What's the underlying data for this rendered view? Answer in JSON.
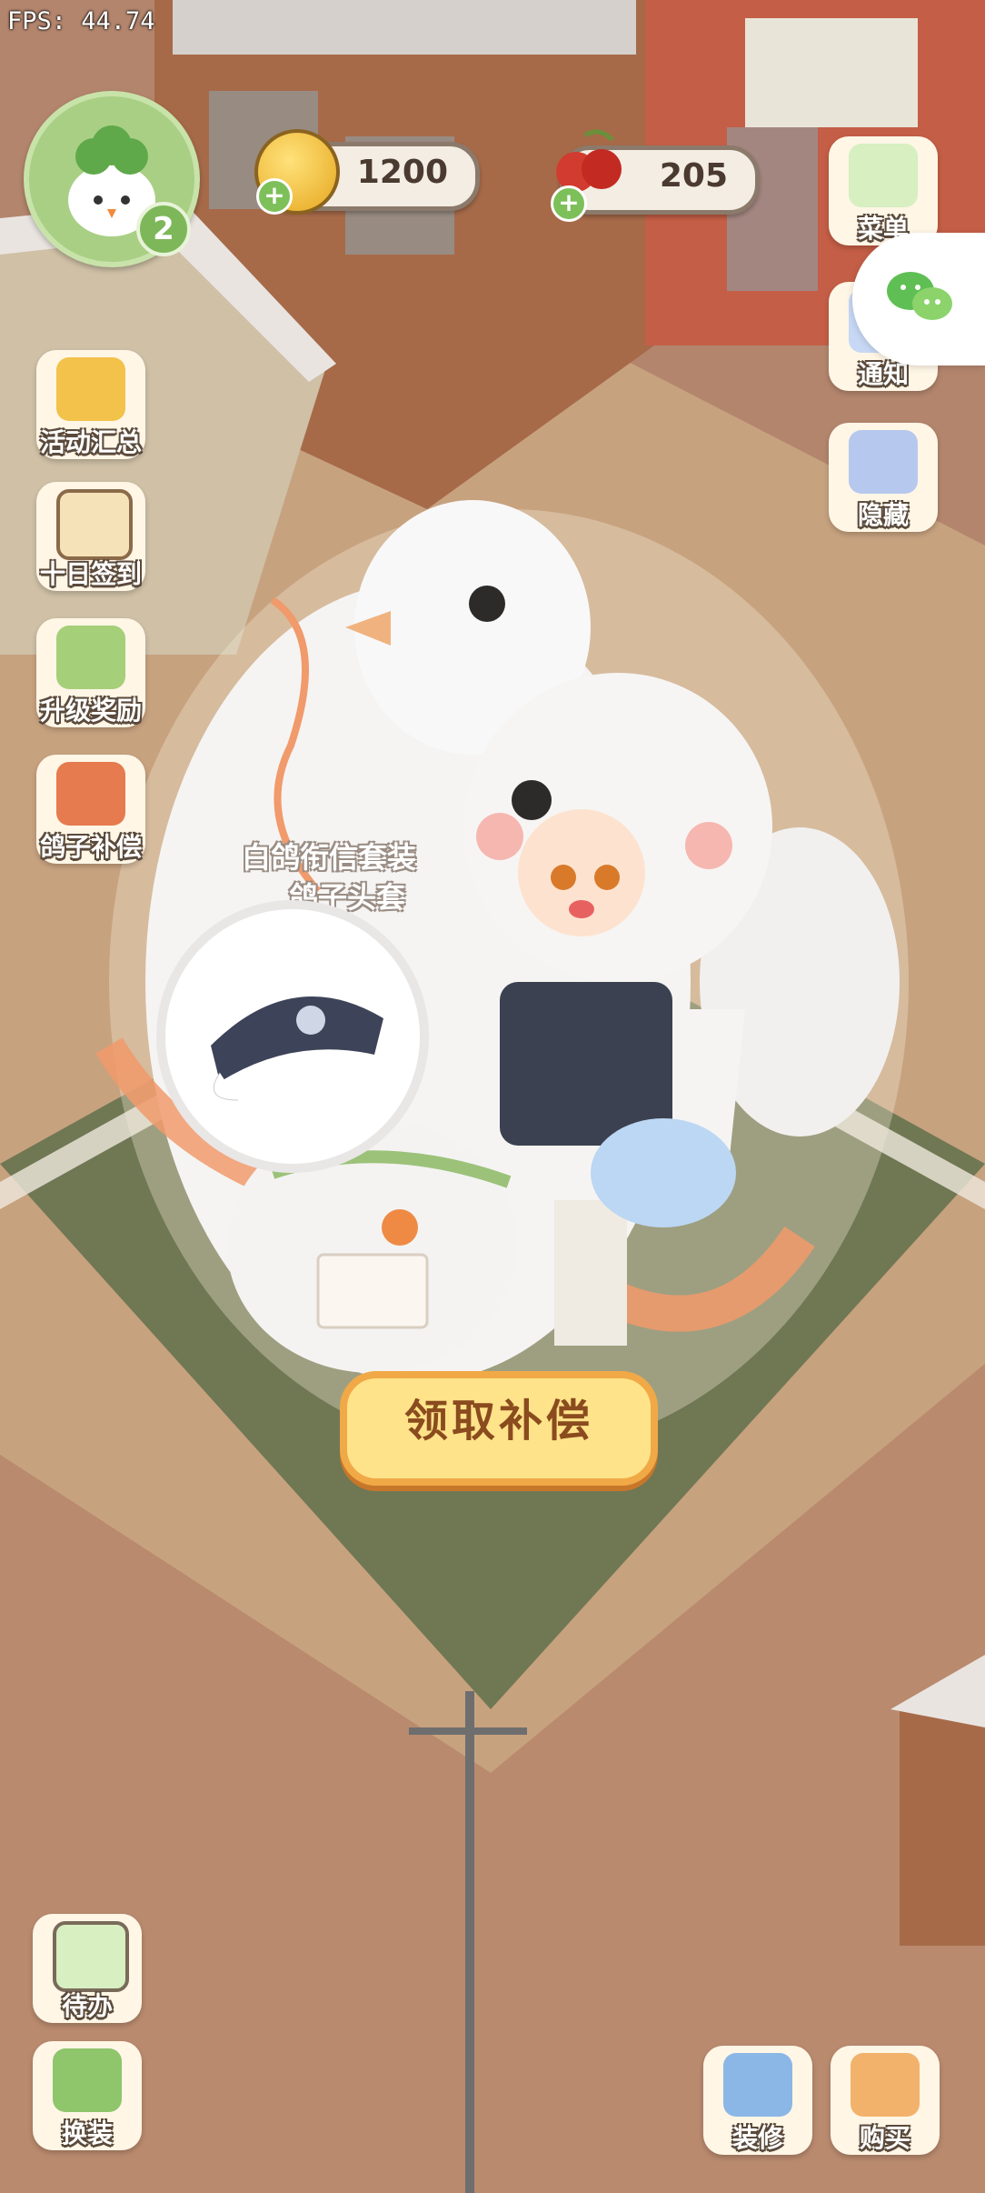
{
  "status": {
    "fps": "FPS: 44.74"
  },
  "player": {
    "level": "2"
  },
  "currencies": [
    {
      "name": "coin",
      "value": "1200"
    },
    {
      "name": "cherry",
      "value": "205"
    }
  ],
  "left_menu": [
    {
      "label": "活动汇总",
      "icon": "crown-icon"
    },
    {
      "label": "十日签到",
      "icon": "calendar-icon"
    },
    {
      "label": "升级奖励",
      "icon": "level-up-icon"
    },
    {
      "label": "鸽子补偿",
      "icon": "pigeon-icon"
    }
  ],
  "right_menu": [
    {
      "label": "菜单",
      "icon": "menu-icon"
    },
    {
      "label": "通知",
      "icon": "notice-icon"
    },
    {
      "label": "隐藏",
      "icon": "hide-icon"
    }
  ],
  "reward": {
    "line1": "白鸽衔信套装",
    "line2": "鸽子头套",
    "button": "领取补偿"
  },
  "bottom_left": [
    {
      "label": "待办",
      "icon": "todo-icon"
    },
    {
      "label": "换装",
      "icon": "dressup-icon"
    }
  ],
  "bottom_right": [
    {
      "label": "装修",
      "icon": "decorate-icon"
    },
    {
      "label": "购买",
      "icon": "shop-icon"
    }
  ],
  "colors": {
    "accent": "#f0a946",
    "button_fill": "#ffe38a",
    "grass": "#6f7a4e"
  }
}
